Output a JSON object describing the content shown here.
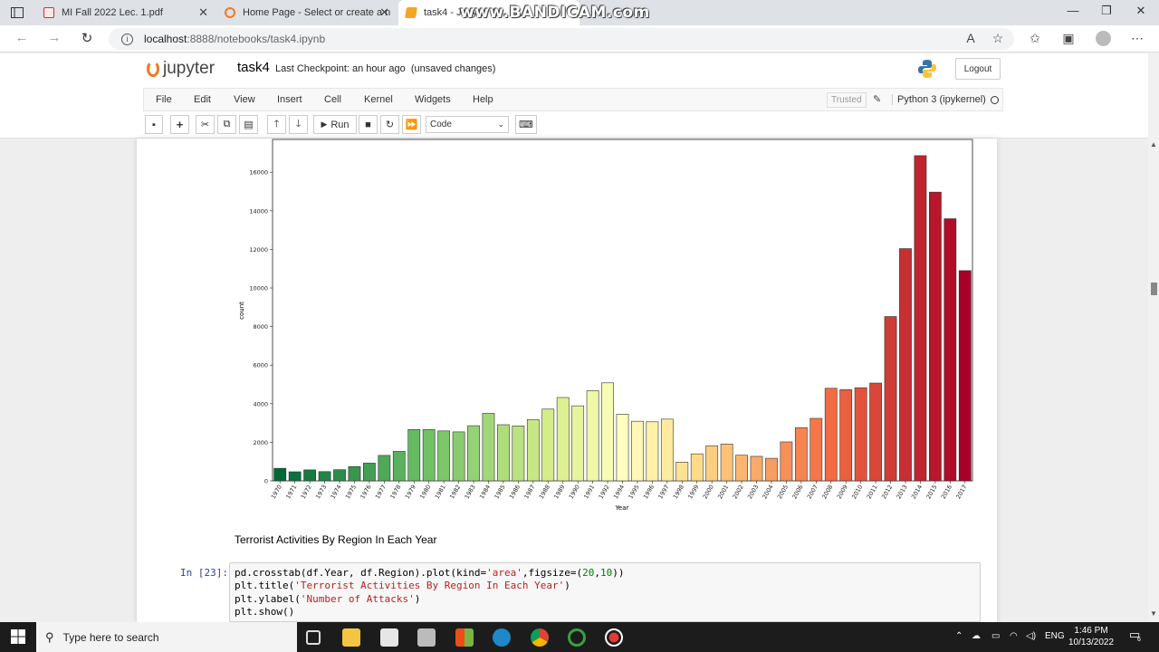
{
  "browser": {
    "tabs": [
      {
        "title": "MI Fall 2022 Lec. 1.pdf",
        "favicon_color": "#d93025",
        "active": false
      },
      {
        "title": "Home Page - Select or create a n",
        "favicon_color": "#f37726",
        "active": false
      },
      {
        "title": "task4 - Jupyter N",
        "favicon_color": "#f5a623",
        "active": true
      }
    ],
    "close_glyph": "✕",
    "url_host": "localhost",
    "url_rest": ":8888/notebooks/task4.ipynb",
    "watermark": "www.BANDICAM.com"
  },
  "jupyter": {
    "logo_text": "jupyter",
    "notebook_name": "task4",
    "checkpoint": "Last Checkpoint: an hour ago",
    "status": "(unsaved changes)",
    "logout_label": "Logout",
    "menu": [
      "File",
      "Edit",
      "View",
      "Insert",
      "Cell",
      "Kernel",
      "Widgets",
      "Help"
    ],
    "trusted_label": "Trusted",
    "kernel_label": "Python 3 (ipykernel)",
    "run_label": "Run",
    "cell_type": "Code"
  },
  "chart_data": {
    "type": "bar",
    "xlabel": "Year",
    "ylabel": "count",
    "ylim": [
      0,
      17700
    ],
    "yticks": [
      0,
      2000,
      4000,
      6000,
      8000,
      10000,
      12000,
      14000,
      16000
    ],
    "categories": [
      "1970",
      "1971",
      "1972",
      "1973",
      "1974",
      "1975",
      "1976",
      "1977",
      "1978",
      "1979",
      "1980",
      "1981",
      "1982",
      "1983",
      "1984",
      "1985",
      "1986",
      "1987",
      "1988",
      "1989",
      "1990",
      "1991",
      "1992",
      "1994",
      "1995",
      "1996",
      "1997",
      "1998",
      "1999",
      "2000",
      "2001",
      "2002",
      "2003",
      "2004",
      "2005",
      "2006",
      "2007",
      "2008",
      "2009",
      "2010",
      "2011",
      "2012",
      "2013",
      "2014",
      "2015",
      "2016",
      "2017"
    ],
    "values": [
      650,
      470,
      570,
      480,
      580,
      740,
      920,
      1320,
      1530,
      2660,
      2660,
      2590,
      2540,
      2860,
      3500,
      2910,
      2850,
      3180,
      3720,
      4320,
      3890,
      4680,
      5080,
      3460,
      3090,
      3060,
      3200,
      970,
      1400,
      1820,
      1910,
      1330,
      1270,
      1170,
      2020,
      2760,
      3240,
      4800,
      4730,
      4830,
      5070,
      8520,
      12040,
      16860,
      14970,
      13590,
      10900
    ],
    "palette": "RdYlGn_r",
    "grid": false
  },
  "markdown_text": "Terrorist Activities By Region In Each Year",
  "code_cell": {
    "prompt": "In [23]:",
    "lines": [
      "pd.crosstab(df.Year, df.Region).plot(kind='area',figsize=(20,10))",
      "plt.title('Terrorist Activities By Region In Each Year')",
      "plt.ylabel('Number of Attacks')",
      "plt.show()"
    ]
  },
  "taskbar": {
    "search_placeholder": "Type here to search",
    "language": "ENG",
    "time": "1:46 PM",
    "date": "10/13/2022",
    "notification_count": "6"
  }
}
